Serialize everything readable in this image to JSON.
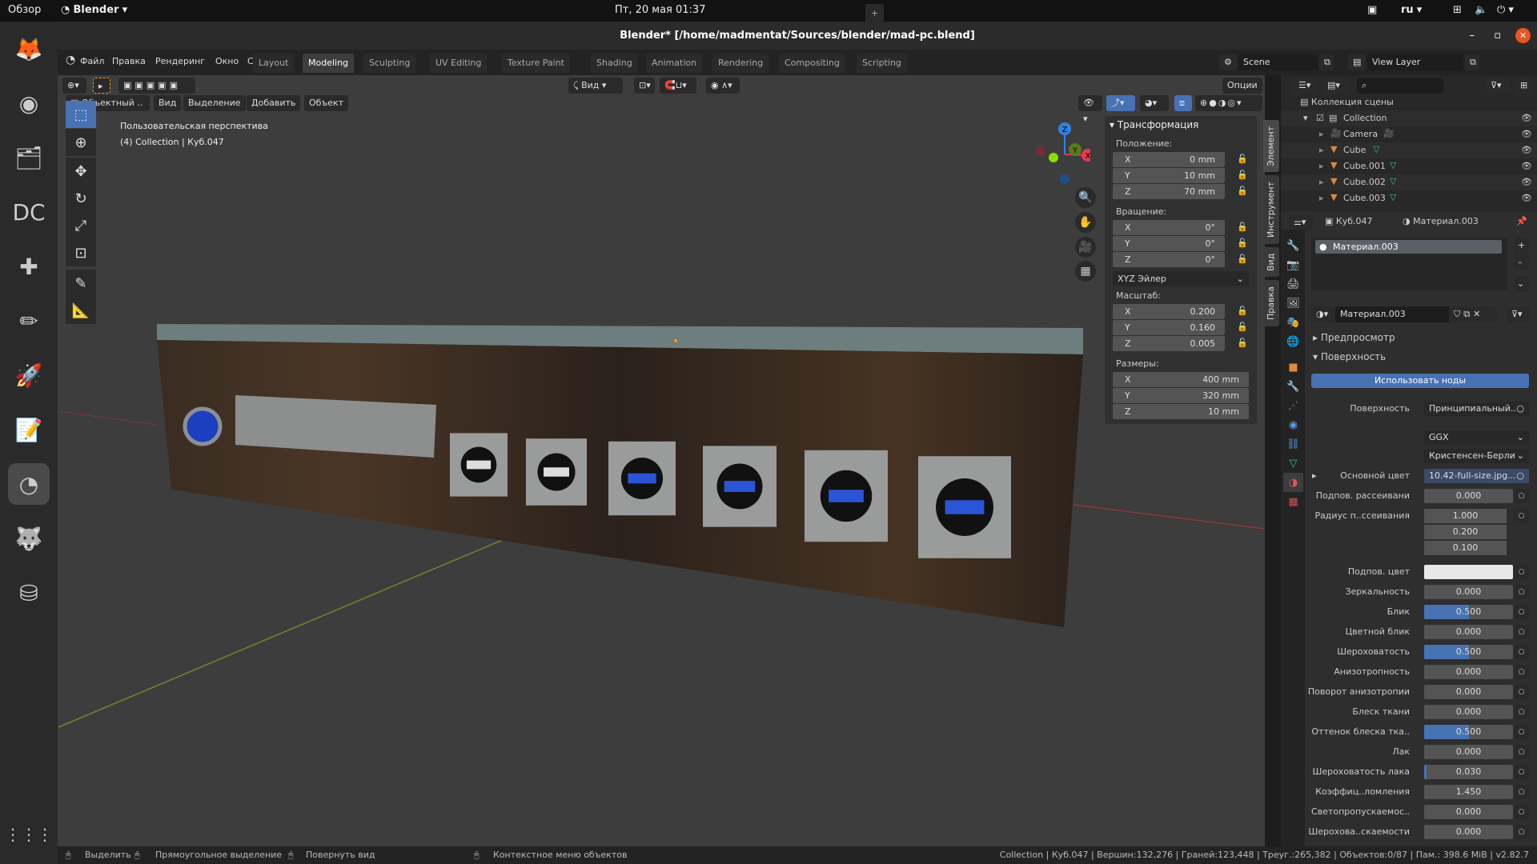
{
  "system_bar": {
    "activities": "Обзор",
    "app_menu": "Blender",
    "clock": "Пт, 20 мая  01:37",
    "lang": "ru"
  },
  "dock": {
    "apps": [
      {
        "name": "firefox",
        "glyph": "🦊"
      },
      {
        "name": "chrome",
        "glyph": "◉"
      },
      {
        "name": "files",
        "glyph": "🗂"
      },
      {
        "name": "double-commander",
        "glyph": "DC"
      },
      {
        "name": "app-grid-tool",
        "glyph": "✚"
      },
      {
        "name": "text-editor-pencil",
        "glyph": "✏"
      },
      {
        "name": "rocket",
        "glyph": "🚀"
      },
      {
        "name": "notes",
        "glyph": "📝"
      },
      {
        "name": "blender",
        "glyph": "◔",
        "active": true
      },
      {
        "name": "gimp",
        "glyph": "🐺"
      },
      {
        "name": "usb-drive",
        "glyph": "⛁"
      }
    ],
    "show_apps": "⋮⋮⋮"
  },
  "window": {
    "title": "Blender* [/home/madmentat/Sources/blender/mad-pc.blend]"
  },
  "menu": [
    "Файл",
    "Правка",
    "Рендеринг",
    "Окно",
    "Справка"
  ],
  "workspaces": [
    {
      "label": "Layout"
    },
    {
      "label": "Modeling",
      "active": true
    },
    {
      "label": "Sculpting"
    },
    {
      "label": "UV Editing"
    },
    {
      "label": "Texture Paint"
    },
    {
      "label": "Shading"
    },
    {
      "label": "Animation"
    },
    {
      "label": "Rendering"
    },
    {
      "label": "Compositing"
    },
    {
      "label": "Scripting"
    }
  ],
  "scene": {
    "scene_name": "Scene",
    "view_layer": "View Layer"
  },
  "viewport": {
    "tool_header": {
      "orientation": "Вид",
      "options": "Опции"
    },
    "mode": "Объектный ..",
    "menus": [
      "Вид",
      "Выделение",
      "Добавить",
      "Объект"
    ],
    "overlay_title": "Пользовательская перспектива",
    "overlay_sub": "(4) Collection | Куб.047",
    "gizmo": {
      "x": "X",
      "y": "Y",
      "z": "Z"
    },
    "tabs": [
      "Элемент",
      "Инструмент",
      "Вид",
      "Правка"
    ]
  },
  "transform": {
    "title": "Трансформация",
    "location_label": "Положение:",
    "location": [
      {
        "axis": "X",
        "value": "0 mm"
      },
      {
        "axis": "Y",
        "value": "10 mm"
      },
      {
        "axis": "Z",
        "value": "70 mm"
      }
    ],
    "rotation_label": "Вращение:",
    "rotation": [
      {
        "axis": "X",
        "value": "0°"
      },
      {
        "axis": "Y",
        "value": "0°"
      },
      {
        "axis": "Z",
        "value": "0°"
      }
    ],
    "rotation_mode": "XYZ Эйлер",
    "scale_label": "Масштаб:",
    "scale": [
      {
        "axis": "X",
        "value": "0.200"
      },
      {
        "axis": "Y",
        "value": "0.160"
      },
      {
        "axis": "Z",
        "value": "0.005"
      }
    ],
    "dimensions_label": "Размеры:",
    "dimensions": [
      {
        "axis": "X",
        "value": "400 mm"
      },
      {
        "axis": "Y",
        "value": "320 mm"
      },
      {
        "axis": "Z",
        "value": "10 mm"
      }
    ]
  },
  "outliner": {
    "root": "Коллекция сцены",
    "collection": "Collection",
    "items": [
      {
        "name": "Camera",
        "type": "camera"
      },
      {
        "name": "Cube",
        "type": "mesh"
      },
      {
        "name": "Cube.001",
        "type": "mesh"
      },
      {
        "name": "Cube.002",
        "type": "mesh"
      },
      {
        "name": "Cube.003",
        "type": "mesh"
      }
    ]
  },
  "properties": {
    "object": "Куб.047",
    "material": "Материал.003",
    "slot": "Материал.003",
    "material_field": "Материал.003",
    "preview": "Предпросмотр",
    "surface_panel": "Поверхность",
    "use_nodes": "Использовать ноды",
    "surface_label": "Поверхность",
    "surface_value": "Принципиальный..",
    "distribution": "GGX",
    "subsurface_method": "Кристенсен-Берли",
    "base_color_label": "Основной цвет",
    "base_color_value": "10.42-full-size.jpg...",
    "rows": [
      {
        "label": "Подпов. рассеивани",
        "value": "0.000",
        "fraction": 0
      },
      {
        "label": "Радиус п..ссеивания",
        "values": [
          "1.000",
          "0.200",
          "0.100"
        ]
      },
      {
        "label": "Подпов. цвет",
        "color": "#e8e8e8"
      },
      {
        "label": "Зеркальность",
        "value": "0.000",
        "fraction": 0
      },
      {
        "label": "Блик",
        "value": "0.500",
        "fraction": 0.5
      },
      {
        "label": "Цветной блик",
        "value": "0.000",
        "fraction": 0
      },
      {
        "label": "Шероховатость",
        "value": "0.500",
        "fraction": 0.5
      },
      {
        "label": "Анизотропность",
        "value": "0.000",
        "fraction": 0
      },
      {
        "label": "Поворот анизотропии",
        "value": "0.000",
        "fraction": 0
      },
      {
        "label": "Блеск ткани",
        "value": "0.000",
        "fraction": 0
      },
      {
        "label": "Оттенок блеска тка..",
        "value": "0.500",
        "fraction": 0.5
      },
      {
        "label": "Лак",
        "value": "0.000",
        "fraction": 0
      },
      {
        "label": "Шероховатость лака",
        "value": "0.030",
        "fraction": 0.03
      },
      {
        "label": "Коэффиц..ломления",
        "value": "1.450"
      },
      {
        "label": "Светопропускаемос..",
        "value": "0.000",
        "fraction": 0
      },
      {
        "label": "Шерохова..скаемости",
        "value": "0.000",
        "fraction": 0
      }
    ]
  },
  "status": {
    "select": "Выделить",
    "box_select": "Прямоугольное выделение",
    "rotate_view": "Повернуть вид",
    "context_menu": "Контекстное меню объектов",
    "stats": "Collection | Куб.047 | Вершин:132,276 | Граней:123,448 | Треуг.:265,382 | Объектов:0/87 | Пам.: 398.6 MiB | v2.82.7"
  },
  "colors": {
    "accent": "#4772b3",
    "selected_tool": "#4772b3",
    "mesh_icon": "#e0893a",
    "data_icon": "#2ec08f",
    "axis_x": "#e8384f",
    "axis_y": "#8bdc00",
    "axis_z": "#2f83e3"
  }
}
